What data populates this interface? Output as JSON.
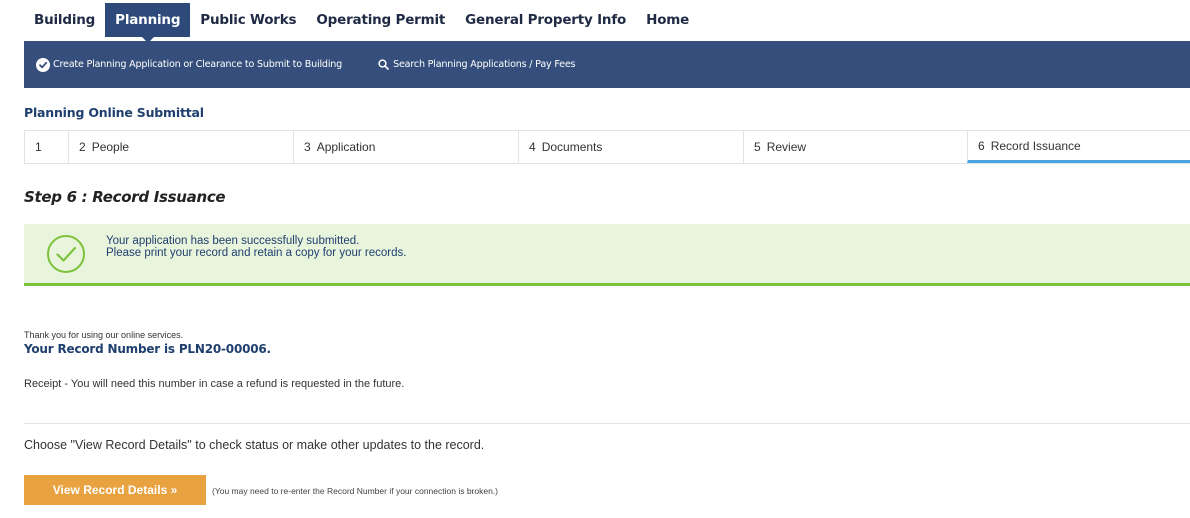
{
  "top_tabs": [
    {
      "label": "Building"
    },
    {
      "label": "Planning"
    },
    {
      "label": "Public Works"
    },
    {
      "label": "Operating Permit"
    },
    {
      "label": "General Property Info"
    },
    {
      "label": "Home"
    }
  ],
  "active_tab": "Planning",
  "action_bar": {
    "create_label": "Create Planning Application or Clearance to Submit to Building",
    "search_label": "Search Planning Applications / Pay Fees"
  },
  "section_title": "Planning Online Submittal",
  "steps": [
    {
      "num": "1",
      "label": ""
    },
    {
      "num": "2",
      "label": "People"
    },
    {
      "num": "3",
      "label": "Application"
    },
    {
      "num": "4",
      "label": "Documents"
    },
    {
      "num": "5",
      "label": "Review"
    },
    {
      "num": "6",
      "label": "Record Issuance"
    }
  ],
  "step_heading": "Step 6 : Record Issuance",
  "success": {
    "line1": "Your application has been successfully submitted.",
    "line2": "Please print your record and retain a copy for your records."
  },
  "thanks_text": "Thank you for using our online services.",
  "record_number_text": "Your Record Number is PLN20-00006.",
  "receipt_text": "Receipt - You will need this number in case a refund is requested in the future.",
  "choose_text": "Choose \"View Record Details\" to check status or make other updates to the record.",
  "view_button_label": "View Record Details »",
  "hint_text": "(You may need to re-enter the Record Number if your connection is broken.)",
  "colors": {
    "nav_blue": "#354e7b",
    "accent_blue": "#4aa3df",
    "success_green": "#7cc23b",
    "button_orange": "#e8a23f"
  }
}
